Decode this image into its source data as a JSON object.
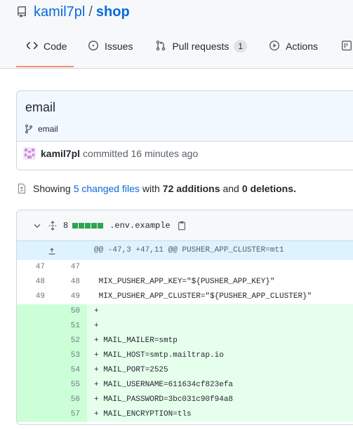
{
  "repo": {
    "owner": "kamil7pl",
    "separator": "/",
    "name": "shop"
  },
  "tabs": [
    {
      "label": "Code",
      "icon": "code-icon",
      "active": true
    },
    {
      "label": "Issues",
      "icon": "issue-icon"
    },
    {
      "label": "Pull requests",
      "icon": "pull-request-icon",
      "count": "1"
    },
    {
      "label": "Actions",
      "icon": "play-icon"
    },
    {
      "label": "",
      "icon": "project-icon"
    }
  ],
  "commit": {
    "title": "email",
    "branch": "email",
    "author": "kamil7pl",
    "action_text": "committed 16 minutes ago"
  },
  "summary": {
    "prefix": "Showing",
    "files_link": "5 changed files",
    "with": "with",
    "additions": "72 additions",
    "and": "and",
    "deletions": "0 deletions."
  },
  "file": {
    "change_count": "8",
    "filename": ".env.example",
    "hunk_header": "@@ -47,3 +47,11 @@ PUSHER_APP_CLUSTER=mt1",
    "lines": [
      {
        "old": "47",
        "new": "47",
        "text": "",
        "type": "context"
      },
      {
        "old": "48",
        "new": "48",
        "text": " MIX_PUSHER_APP_KEY=\"${PUSHER_APP_KEY}\"",
        "type": "context"
      },
      {
        "old": "49",
        "new": "49",
        "text": " MIX_PUSHER_APP_CLUSTER=\"${PUSHER_APP_CLUSTER}\"",
        "type": "context"
      },
      {
        "old": "",
        "new": "50",
        "text": "+",
        "type": "add"
      },
      {
        "old": "",
        "new": "51",
        "text": "+",
        "type": "add"
      },
      {
        "old": "",
        "new": "52",
        "text": "+ MAIL_MAILER=smtp",
        "type": "add"
      },
      {
        "old": "",
        "new": "53",
        "text": "+ MAIL_HOST=smtp.mailtrap.io",
        "type": "add"
      },
      {
        "old": "",
        "new": "54",
        "text": "+ MAIL_PORT=2525",
        "type": "add"
      },
      {
        "old": "",
        "new": "55",
        "text": "+ MAIL_USERNAME=611634cf823efa",
        "type": "add"
      },
      {
        "old": "",
        "new": "56",
        "text": "+ MAIL_PASSWORD=3bc031c90f94a8",
        "type": "add"
      },
      {
        "old": "",
        "new": "57",
        "text": "+ MAIL_ENCRYPTION=tls",
        "type": "add"
      }
    ]
  },
  "colors": {
    "link": "#0969da",
    "active_tab_underline": "#fd8c73",
    "addition_green": "#2da44e"
  }
}
